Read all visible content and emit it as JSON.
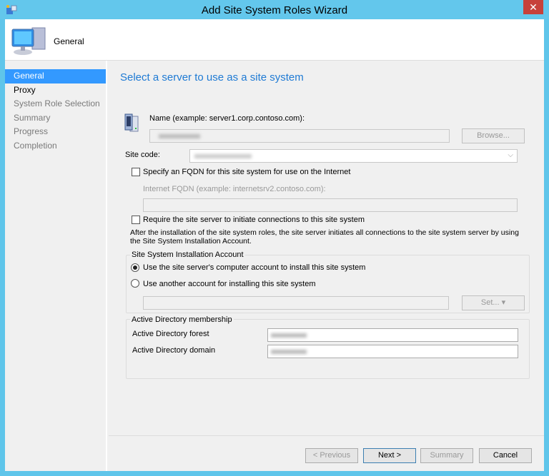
{
  "window": {
    "title": "Add Site System Roles Wizard",
    "close": "✕"
  },
  "header": {
    "title": "General"
  },
  "nav": {
    "items": [
      {
        "label": "General"
      },
      {
        "label": "Proxy"
      },
      {
        "label": "System Role Selection"
      },
      {
        "label": "Summary"
      },
      {
        "label": "Progress"
      },
      {
        "label": "Completion"
      }
    ]
  },
  "main": {
    "heading": "Select a server to use as a site system",
    "name_label": "Name (example: server1.corp.contoso.com):",
    "browse": "Browse...",
    "site_code_label": "Site code:",
    "fqdn_checkbox": "Specify an FQDN for this site system for use on the Internet",
    "fqdn_label": "Internet FQDN (example: internetsrv2.contoso.com):",
    "require_checkbox": "Require the site server to initiate connections to this site system",
    "require_note": "After the  installation of the site system roles, the site server initiates all connections to the site system server by using the Site System Installation Account.",
    "install_group": "Site System Installation Account",
    "radio_computer": "Use the site server's computer account to install this site system",
    "radio_another": "Use another account for installing this site system",
    "set": "Set...",
    "ad_group": "Active Directory membership",
    "ad_forest_label": "Active Directory forest",
    "ad_domain_label": "Active Directory domain"
  },
  "footer": {
    "previous": "< Previous",
    "next": "Next >",
    "summary": "Summary",
    "cancel": "Cancel"
  }
}
